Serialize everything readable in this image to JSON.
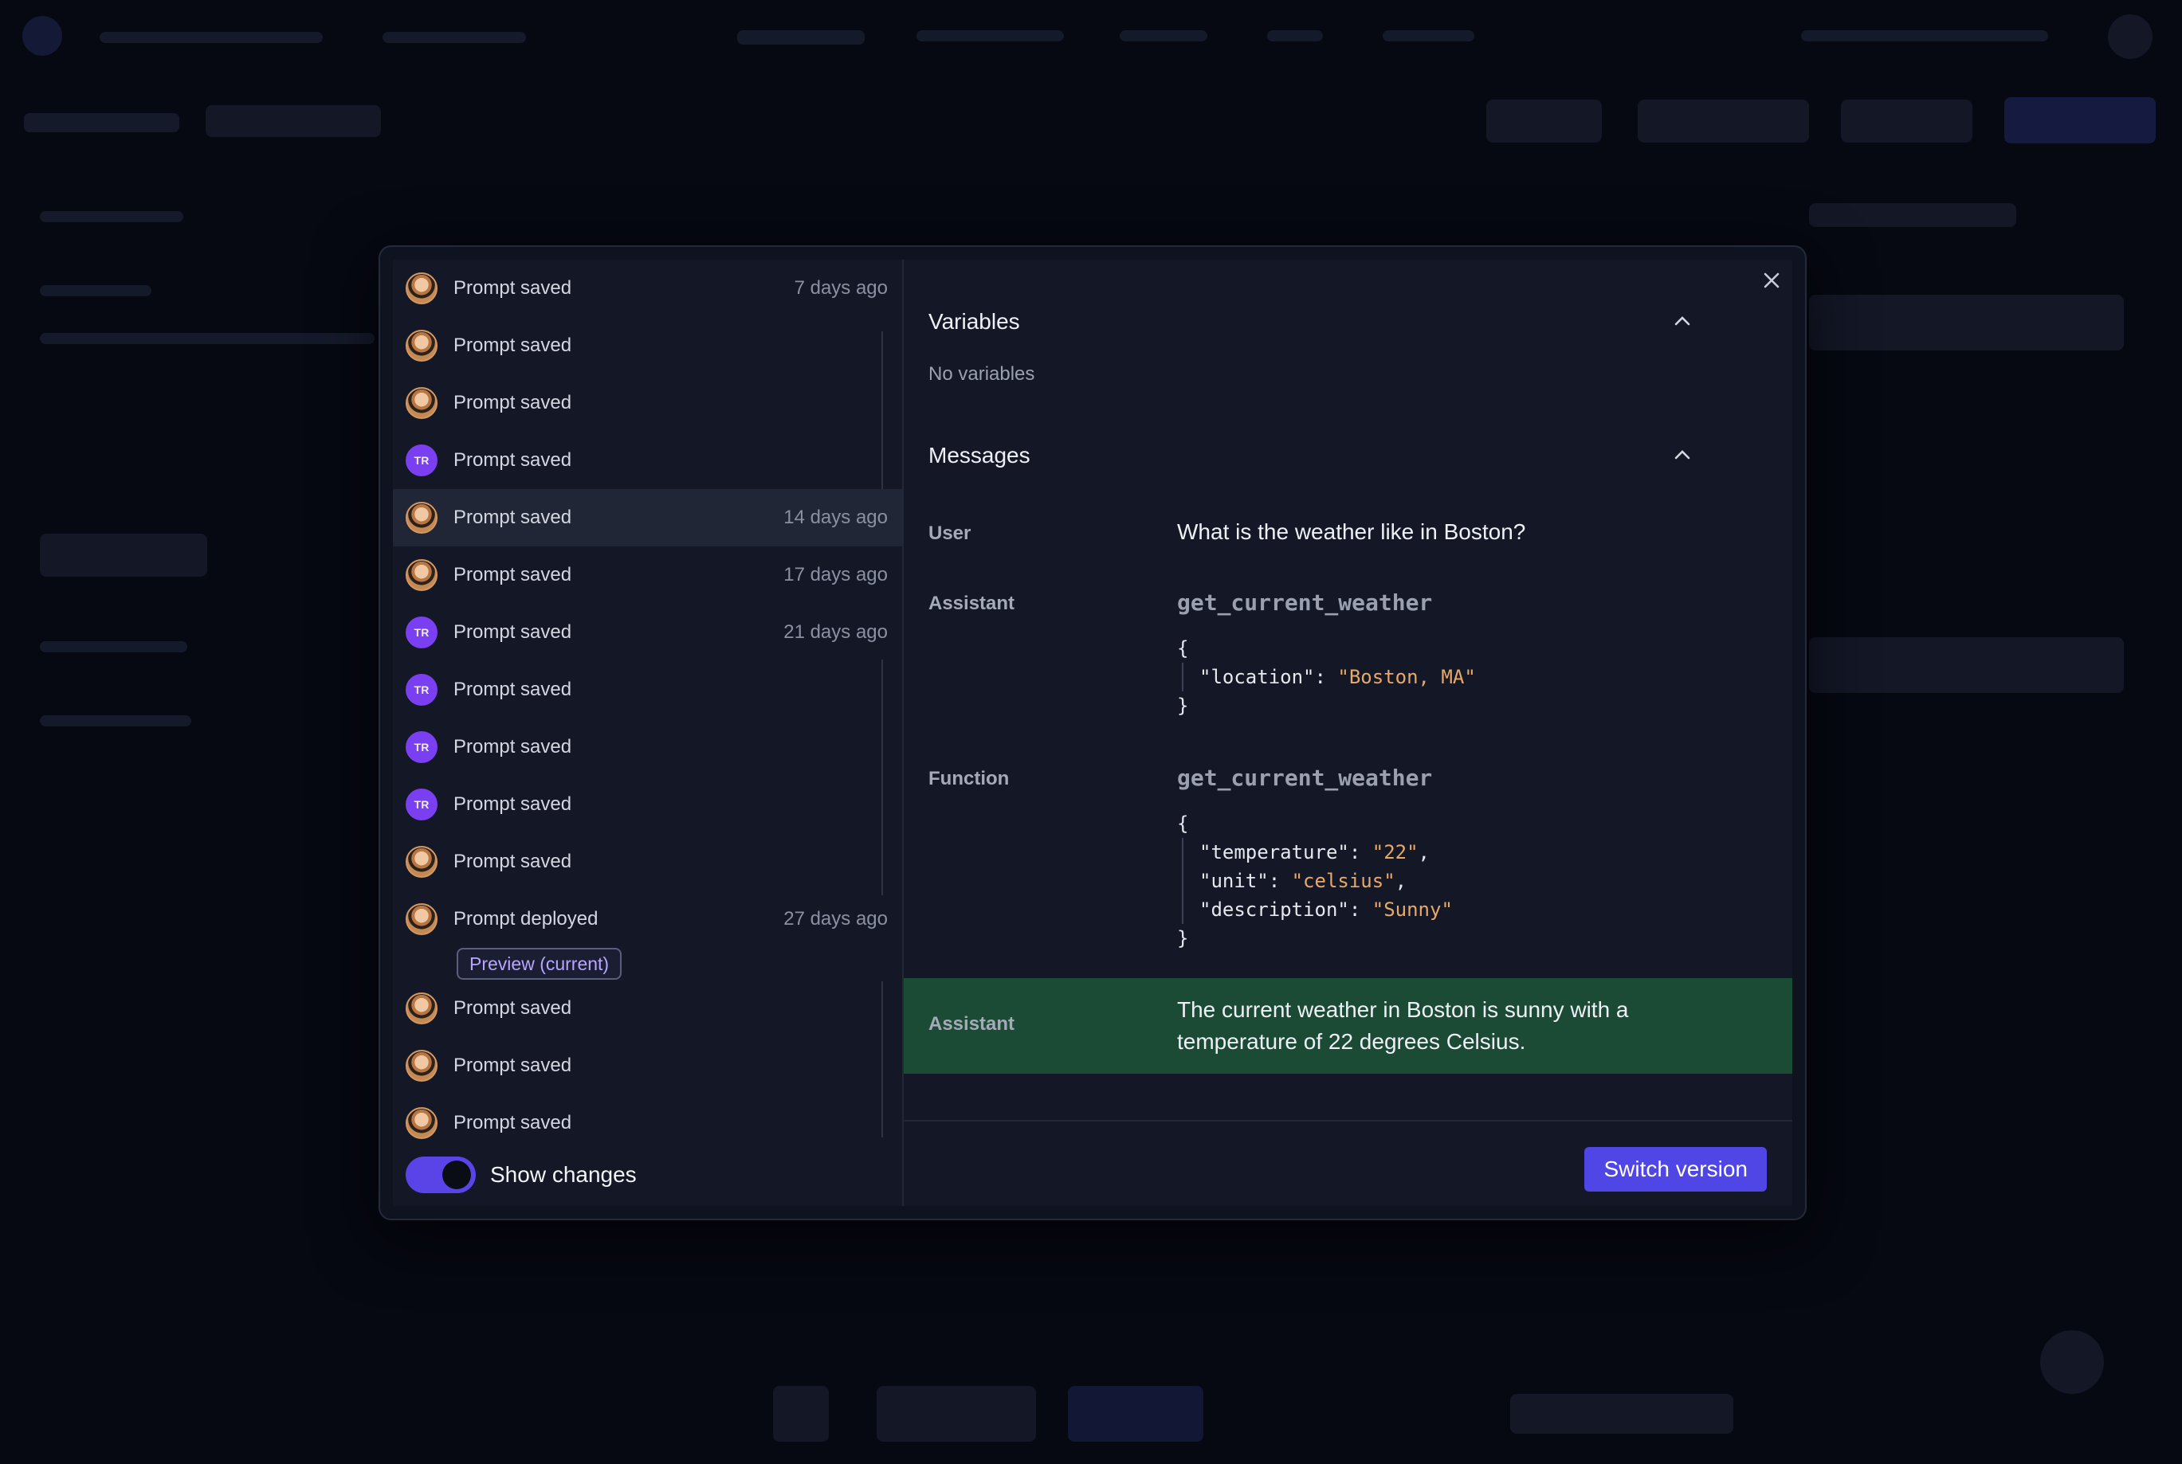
{
  "history": {
    "items": [
      {
        "label": "Prompt saved",
        "time": "7 days ago",
        "avatar": "photo"
      },
      {
        "label": "Prompt saved",
        "time": "",
        "avatar": "photo"
      },
      {
        "label": "Prompt saved",
        "time": "",
        "avatar": "photo"
      },
      {
        "label": "Prompt saved",
        "time": "",
        "avatar": "TR"
      },
      {
        "label": "Prompt saved",
        "time": "14 days ago",
        "avatar": "photo"
      },
      {
        "label": "Prompt saved",
        "time": "17 days ago",
        "avatar": "photo"
      },
      {
        "label": "Prompt saved",
        "time": "21 days ago",
        "avatar": "TR"
      },
      {
        "label": "Prompt saved",
        "time": "",
        "avatar": "TR"
      },
      {
        "label": "Prompt saved",
        "time": "",
        "avatar": "TR"
      },
      {
        "label": "Prompt saved",
        "time": "",
        "avatar": "TR"
      },
      {
        "label": "Prompt saved",
        "time": "",
        "avatar": "photo"
      },
      {
        "label": "Prompt deployed",
        "time": "27 days ago",
        "avatar": "photo",
        "badge": "Preview (current)"
      },
      {
        "label": "Prompt saved",
        "time": "",
        "avatar": "photo"
      },
      {
        "label": "Prompt saved",
        "time": "",
        "avatar": "photo"
      },
      {
        "label": "Prompt saved",
        "time": "",
        "avatar": "photo"
      }
    ],
    "toggle_label": "Show changes",
    "toggle_on": true
  },
  "detail": {
    "variables_title": "Variables",
    "variables_empty": "No variables",
    "messages_title": "Messages",
    "messages": {
      "user_role": "User",
      "user_text": "What is the weather like in Boston?",
      "assistant_role": "Assistant",
      "assistant_fn": "get_current_weather",
      "assistant_args_open": "{",
      "assistant_arg_key": "\"location\": ",
      "assistant_arg_val": "\"Boston, MA\"",
      "assistant_args_close": "}",
      "function_role": "Function",
      "function_fn": "get_current_weather",
      "function_open": "{",
      "function_k1": "\"temperature\": ",
      "function_v1": "\"22\"",
      "function_k2": "\"unit\": ",
      "function_v2": "\"celsius\"",
      "function_k3": "\"description\": ",
      "function_v3": "\"Sunny\"",
      "function_close": "}",
      "final_role": "Assistant",
      "final_text_1": "The current weather in Boston is sunny with a",
      "final_text_2": "temperature of 22 degrees Celsius."
    },
    "switch_label": "Switch version"
  },
  "colors": {
    "accent": "#4f46e5",
    "highlight": "#1b4a35",
    "string": "#e8a867"
  }
}
